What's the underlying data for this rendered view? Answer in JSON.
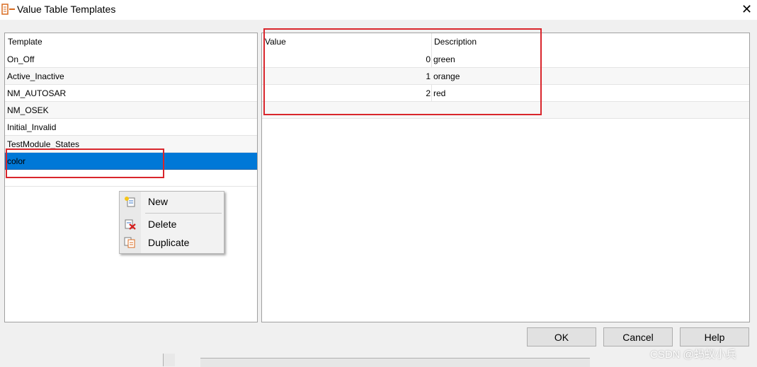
{
  "window": {
    "title": "Value Table Templates",
    "close_glyph": "✕"
  },
  "templates": {
    "header": "Template",
    "items": [
      {
        "label": "On_Off"
      },
      {
        "label": "Active_Inactive"
      },
      {
        "label": "NM_AUTOSAR"
      },
      {
        "label": "NM_OSEK"
      },
      {
        "label": "Initial_Invalid"
      },
      {
        "label": "TestModule_States"
      },
      {
        "label": "color",
        "selected": true
      }
    ]
  },
  "values": {
    "headers": {
      "value": "Value",
      "description": "Description"
    },
    "rows": [
      {
        "value": "0",
        "description": "green"
      },
      {
        "value": "1",
        "description": "orange"
      },
      {
        "value": "2",
        "description": "red"
      }
    ]
  },
  "context_menu": {
    "items": [
      {
        "label": "New",
        "icon": "new-template-icon"
      },
      {
        "label": "Delete",
        "icon": "delete-template-icon"
      },
      {
        "label": "Duplicate",
        "icon": "duplicate-template-icon"
      }
    ]
  },
  "buttons": {
    "ok": "OK",
    "cancel": "Cancel",
    "help": "Help"
  },
  "watermark": "CSDN @蚂蚁小兵",
  "colors": {
    "selection": "#0078d7",
    "highlight_box": "#d9262c",
    "window_bg": "#f0f0f0"
  }
}
